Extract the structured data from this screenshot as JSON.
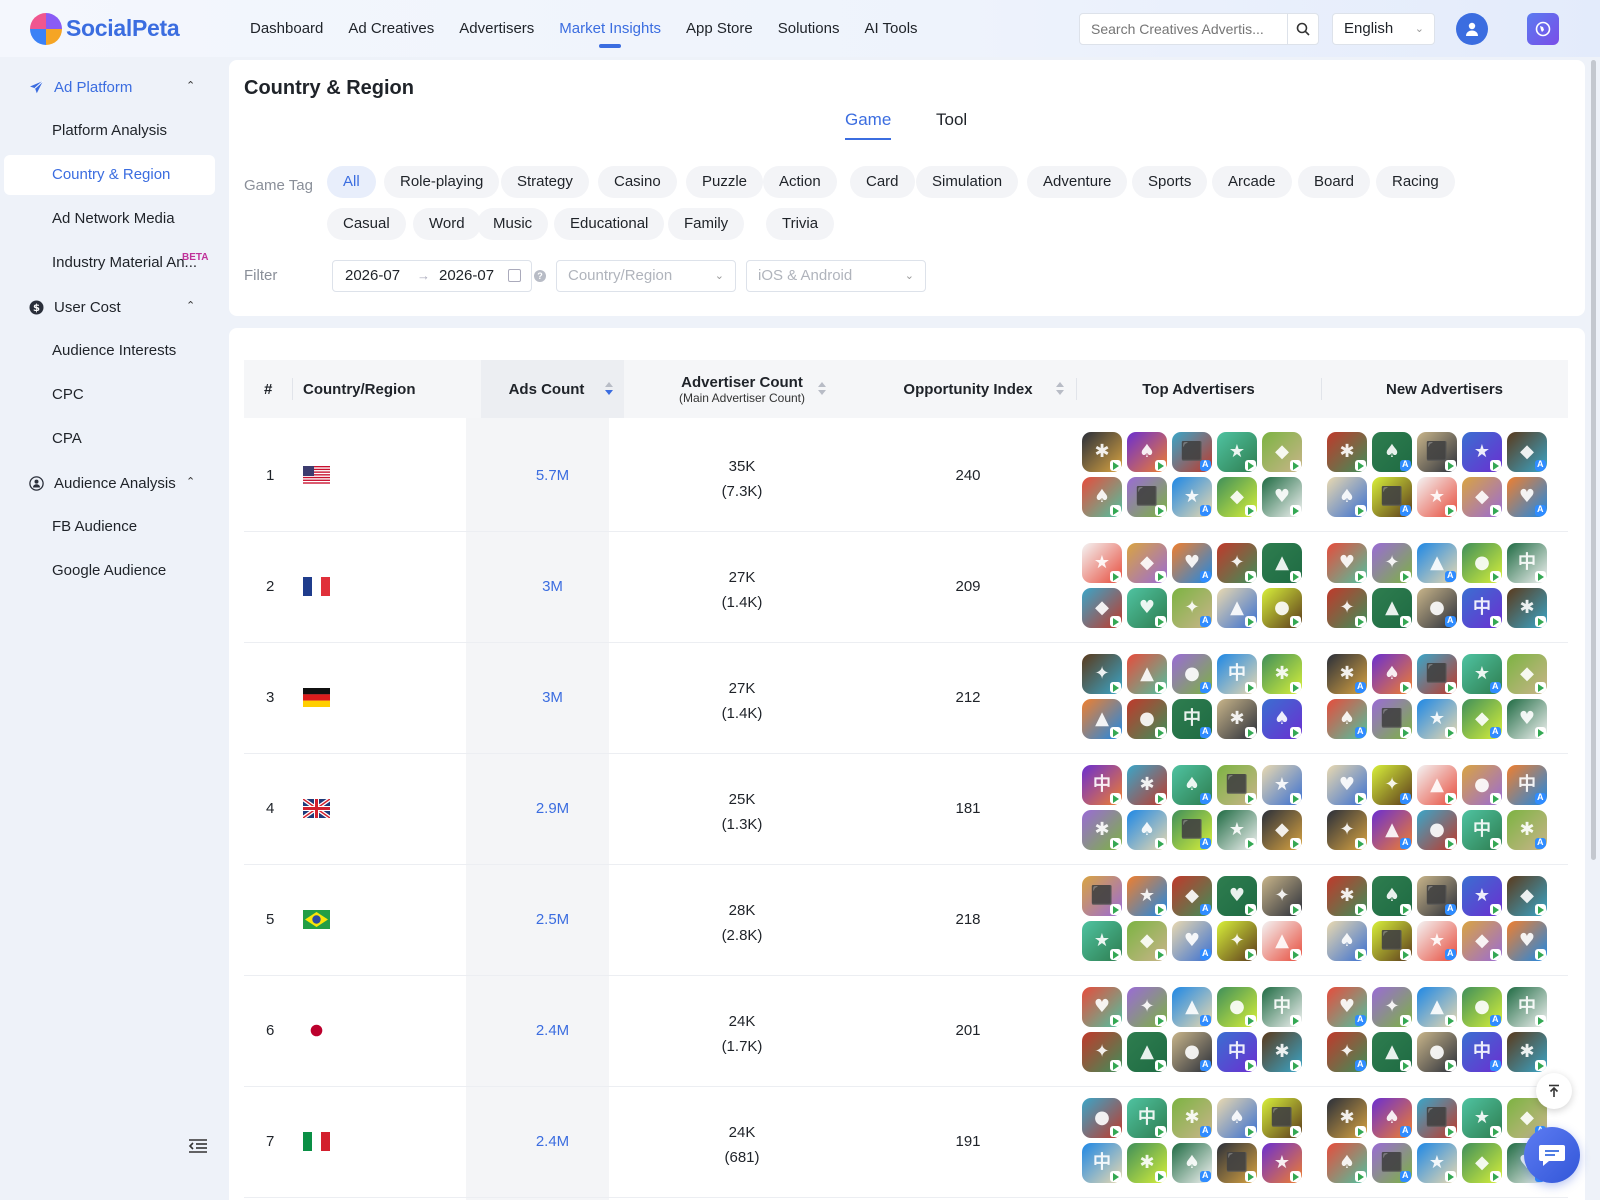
{
  "app": {
    "brand": "SocialPeta",
    "brand_color": "#3b6de0"
  },
  "nav": {
    "items": [
      {
        "label": "Dashboard",
        "active": false
      },
      {
        "label": "Ad Creatives",
        "active": false
      },
      {
        "label": "Advertisers",
        "active": false
      },
      {
        "label": "Market Insights",
        "active": true
      },
      {
        "label": "App Store",
        "active": false
      },
      {
        "label": "Solutions",
        "active": false
      },
      {
        "label": "AI Tools",
        "active": false
      }
    ],
    "search_placeholder": "Search Creatives Advertis...",
    "language": "English"
  },
  "sidebar": {
    "groups": [
      {
        "label": "Ad Platform",
        "icon": "paper-plane-icon",
        "active": true,
        "items": [
          {
            "label": "Platform Analysis",
            "active": false
          },
          {
            "label": "Country & Region",
            "active": true
          },
          {
            "label": "Ad Network Media",
            "active": false
          },
          {
            "label": "Industry Material An...",
            "active": false,
            "badge": "BETA"
          }
        ]
      },
      {
        "label": "User Cost",
        "icon": "dollar-icon",
        "active": false,
        "items": [
          {
            "label": "Audience Interests",
            "active": false
          },
          {
            "label": "CPC",
            "active": false
          },
          {
            "label": "CPA",
            "active": false
          }
        ]
      },
      {
        "label": "Audience Analysis",
        "icon": "audience-icon",
        "active": false,
        "items": [
          {
            "label": "FB Audience",
            "active": false
          },
          {
            "label": "Google Audience",
            "active": false
          }
        ]
      }
    ]
  },
  "page": {
    "title": "Country & Region",
    "tabs": [
      {
        "label": "Game",
        "active": true
      },
      {
        "label": "Tool",
        "active": false
      }
    ],
    "game_tag_label": "Game Tag",
    "tags_row1": [
      "All",
      "Role-playing",
      "Strategy",
      "Casino",
      "Puzzle",
      "Action",
      "Card",
      "Simulation",
      "Adventure",
      "Sports",
      "Arcade",
      "Board",
      "Racing"
    ],
    "tags_row2": [
      "Casual",
      "Word",
      "Music",
      "Educational",
      "Family",
      "Trivia"
    ],
    "active_tag": "All",
    "filter_label": "Filter",
    "date_start": "2026-07",
    "date_end": "2026-07",
    "date_arrow": "→",
    "info_mark": "?",
    "country_placeholder": "Country/Region",
    "platform_placeholder": "iOS & Android"
  },
  "table": {
    "headers": {
      "index": "#",
      "country": "Country/Region",
      "ads": "Ads Count",
      "advertiser": "Advertiser Count",
      "advertiser_sub": "(Main Advertiser Count)",
      "opportunity": "Opportunity Index",
      "top": "Top Advertisers",
      "new": "New Advertisers"
    },
    "rows": [
      {
        "index": "1",
        "flag": "us-flag",
        "ads": "5.7M",
        "adv": "35K",
        "adv_main": "(7.3K)",
        "opp": "240"
      },
      {
        "index": "2",
        "flag": "fr-flag",
        "ads": "3M",
        "adv": "27K",
        "adv_main": "(1.4K)",
        "opp": "209"
      },
      {
        "index": "3",
        "flag": "de-flag",
        "ads": "3M",
        "adv": "27K",
        "adv_main": "(1.4K)",
        "opp": "212"
      },
      {
        "index": "4",
        "flag": "gb-flag",
        "ads": "2.9M",
        "adv": "25K",
        "adv_main": "(1.3K)",
        "opp": "181"
      },
      {
        "index": "5",
        "flag": "br-flag",
        "ads": "2.5M",
        "adv": "28K",
        "adv_main": "(2.8K)",
        "opp": "218"
      },
      {
        "index": "6",
        "flag": "jp-flag",
        "ads": "2.4M",
        "adv": "24K",
        "adv_main": "(1.7K)",
        "opp": "201"
      },
      {
        "index": "7",
        "flag": "it-flag",
        "ads": "2.4M",
        "adv": "24K",
        "adv_main": "(681)",
        "opp": "191"
      }
    ],
    "icon_palette": [
      "#2e7d4f",
      "#3f8f5a",
      "#e9d9b0",
      "#c9b58a",
      "#1f6b43",
      "#d8f03a",
      "#3a6fd1",
      "#2a2f3a",
      "#f4f4f4",
      "#5b3a1c",
      "#6b2fd1",
      "#d9a441",
      "#e74c3c",
      "#3aa6c9",
      "#f07f2e",
      "#9a6bd6",
      "#4fc3a1",
      "#c0392b",
      "#1e88e5",
      "#7cb342"
    ]
  }
}
